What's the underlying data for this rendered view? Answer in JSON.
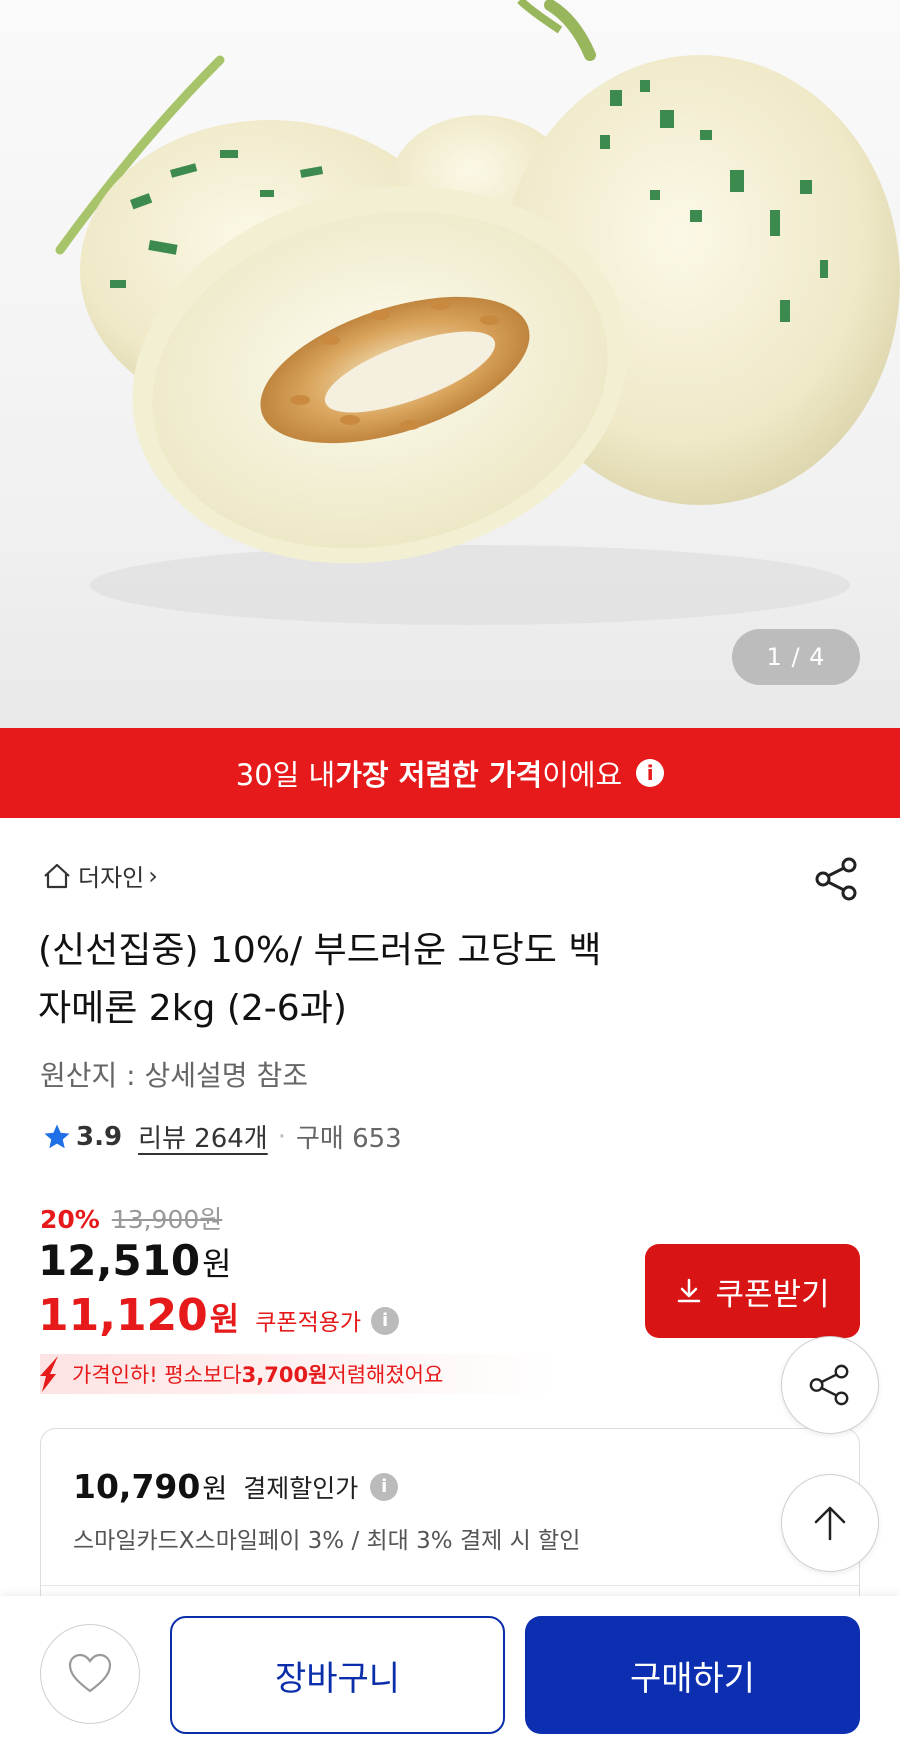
{
  "gallery": {
    "image_alt": "white melon product photo",
    "pager_current": "1",
    "pager_total": "4",
    "pager_text": "1 / 4"
  },
  "banner": {
    "prefix": "30일 내 ",
    "highlight": "가장 저렴한 가격",
    "suffix": "이에요",
    "info_icon": "info-icon",
    "color": "#e61a1a"
  },
  "store": {
    "name": "더자인",
    "icon": "home-icon"
  },
  "product": {
    "title_line1": "(신선집중) 10%/ 부드러운 고당도 백",
    "title_line2": "자메론 2kg (2-6과)",
    "origin": "원산지 : 상세설명 참조",
    "rating": "3.9",
    "reviews": "리뷰 264개",
    "purchases": "구매 653"
  },
  "pricing": {
    "discount_pct": "20%",
    "original_price": "13,900",
    "original_unit": "원",
    "sale_price": "12,510",
    "sale_unit": "원",
    "coupon_price": "11,120",
    "coupon_unit": "원",
    "coupon_label": "쿠폰적용가",
    "coupon_button": "쿠폰받기",
    "drop_prefix": "가격인하! 평소보다 ",
    "drop_amount": "3,700원",
    "drop_suffix": " 저렴해졌어요",
    "accent_color": "#e61a1a"
  },
  "payment": {
    "price": "10,790",
    "unit": "원",
    "label": "결제할인가",
    "description": "스마일카드X스마일페이 3% / 최대 3% 결제 시 할인"
  },
  "bottom_bar": {
    "cart_label": "장바구니",
    "buy_label": "구매하기",
    "brand_color": "#0b2fb0"
  }
}
